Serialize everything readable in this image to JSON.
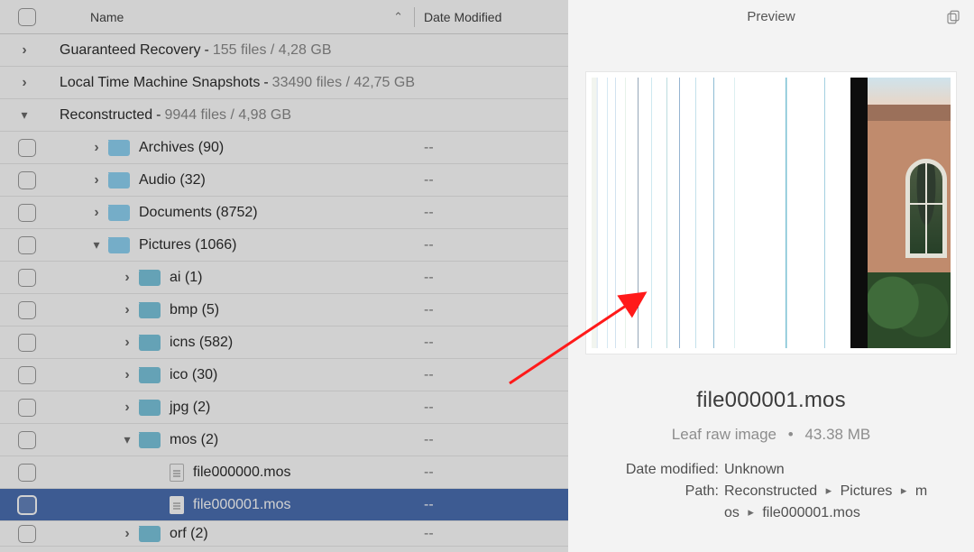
{
  "header": {
    "name_label": "Name",
    "date_label": "Date Modified",
    "preview_label": "Preview"
  },
  "roots": {
    "guaranteed": {
      "name": "Guaranteed Recovery",
      "sub": "155 files / 4,28 GB"
    },
    "ltms": {
      "name": "Local Time Machine Snapshots",
      "sub": "33490 files / 42,75 GB"
    },
    "reconstructed": {
      "name": "Reconstructed",
      "sub": "9944 files / 4,98 GB"
    }
  },
  "folders": {
    "archives": {
      "label": "Archives (90)",
      "date": "--"
    },
    "audio": {
      "label": "Audio (32)",
      "date": "--"
    },
    "documents": {
      "label": "Documents (8752)",
      "date": "--"
    },
    "pictures": {
      "label": "Pictures (1066)",
      "date": "--"
    },
    "ai": {
      "label": "ai (1)",
      "date": "--"
    },
    "bmp": {
      "label": "bmp (5)",
      "date": "--"
    },
    "icns": {
      "label": "icns (582)",
      "date": "--"
    },
    "ico": {
      "label": "ico (30)",
      "date": "--"
    },
    "jpg": {
      "label": "jpg (2)",
      "date": "--"
    },
    "mos": {
      "label": "mos (2)",
      "date": "--"
    },
    "orf": {
      "label": "orf (2)",
      "date": "--"
    }
  },
  "files": {
    "f0": {
      "name": "file000000.mos",
      "date": "--"
    },
    "f1": {
      "name": "file000001.mos",
      "date": "--"
    }
  },
  "preview": {
    "filename": "file000001.mos",
    "kind": "Leaf raw image",
    "size": "43.38 MB",
    "date_modified_label": "Date modified:",
    "date_modified_value": "Unknown",
    "path_label": "Path:",
    "path_parts": [
      "Reconstructed",
      "Pictures",
      "mos",
      "file000001.mos"
    ],
    "path_display_line1_a": "Reconstructed",
    "path_display_line1_b": "Pictures",
    "path_display_line1_c": "m",
    "path_display_line2_a": "os",
    "path_display_line2_b": "file000001.mos"
  },
  "colors": {
    "selection": "#4b6fb3",
    "folder": "#8fd3f4",
    "arrow": "#ff1a1a"
  }
}
